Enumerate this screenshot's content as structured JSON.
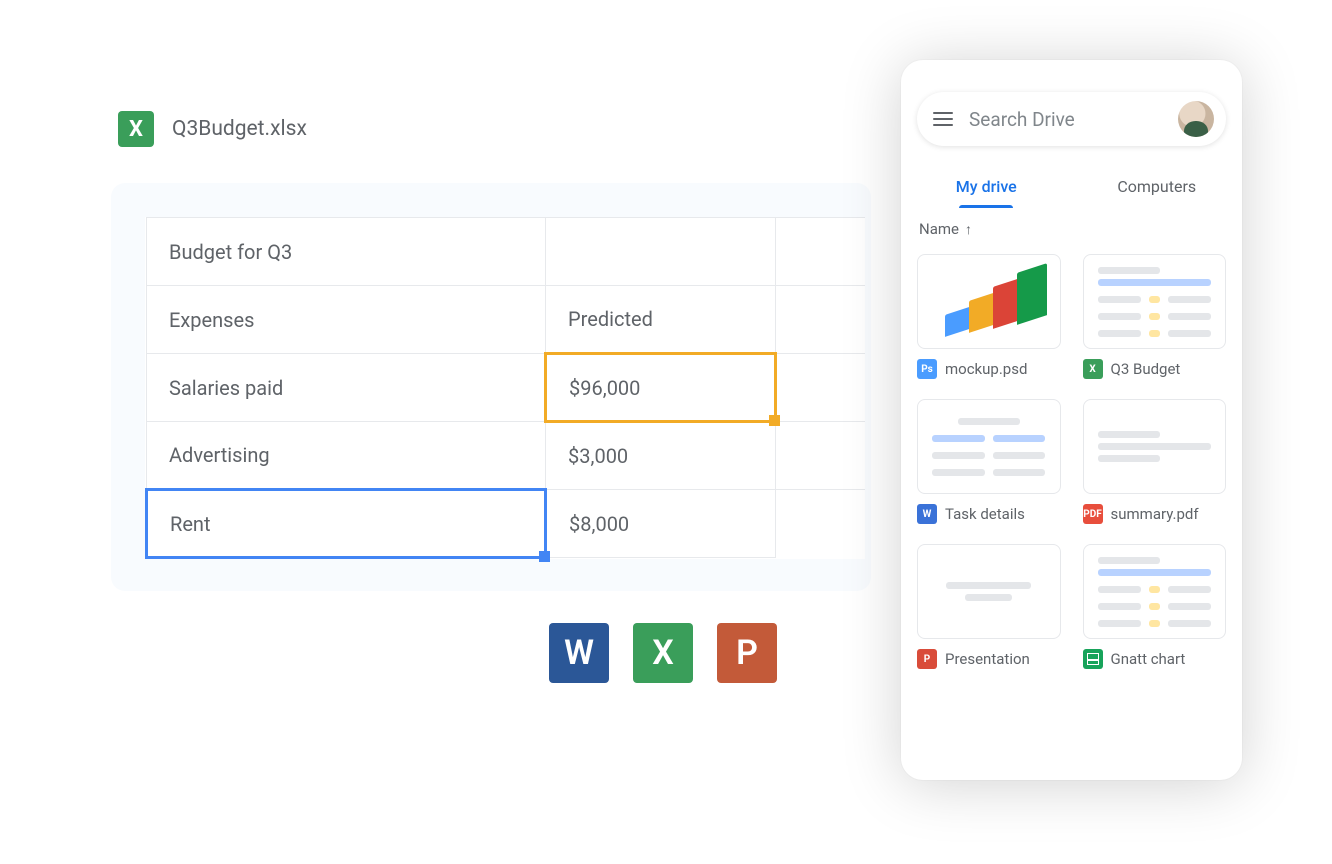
{
  "spreadsheet": {
    "icon_letter": "X",
    "filename": "Q3Budget.xlsx",
    "rows": [
      {
        "a": "Budget for Q3",
        "b": ""
      },
      {
        "a": "Expenses",
        "b": "Predicted"
      },
      {
        "a": "Salaries paid",
        "b": "$96,000"
      },
      {
        "a": "Advertising",
        "b": "$3,000"
      },
      {
        "a": "Rent",
        "b": "$8,000"
      }
    ]
  },
  "app_icons": {
    "word": "W",
    "excel": "X",
    "powerpoint": "P"
  },
  "drive": {
    "search_placeholder": "Search Drive",
    "tabs": {
      "my_drive": "My drive",
      "computers": "Computers"
    },
    "sort_label": "Name",
    "sort_arrow": "↑",
    "files": [
      {
        "badge": "Ps",
        "badge_class": "b-psd",
        "name": "mockup.psd",
        "thumb": "chart"
      },
      {
        "badge": "X",
        "badge_class": "b-xlsx",
        "name": "Q3 Budget",
        "thumb": "sheet"
      },
      {
        "badge": "W",
        "badge_class": "b-docx",
        "name": "Task details",
        "thumb": "doc-blue"
      },
      {
        "badge": "PDF",
        "badge_class": "b-pdf",
        "name": "summary.pdf",
        "thumb": "doc-grey"
      },
      {
        "badge": "P",
        "badge_class": "b-ppt",
        "name": "Presentation",
        "thumb": "doc-grey"
      },
      {
        "badge": "",
        "badge_class": "b-sheets",
        "name": "Gnatt chart",
        "thumb": "sheet"
      }
    ]
  }
}
